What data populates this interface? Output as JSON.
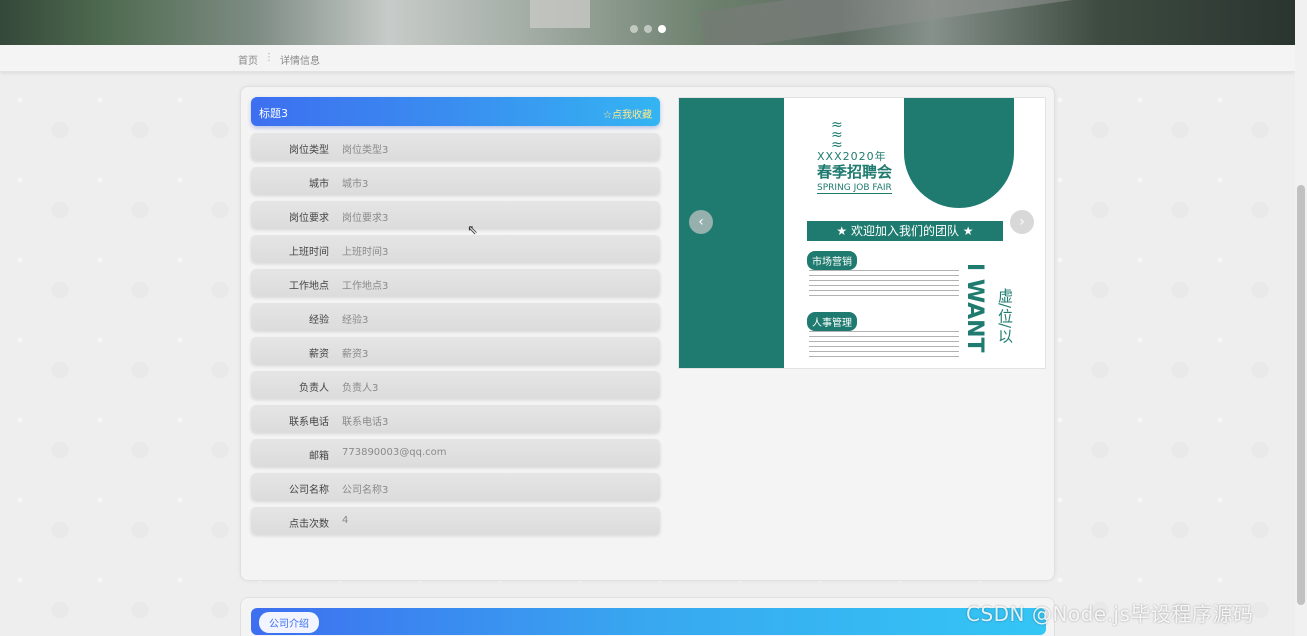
{
  "carousel": {
    "dots": 3,
    "active_index": 2
  },
  "breadcrumb": {
    "home": "首页",
    "separator": "⋮",
    "current": "详情信息"
  },
  "detail": {
    "title": "标题3",
    "favorite_label": "☆点我收藏",
    "fields": [
      {
        "label": "岗位类型",
        "value": "岗位类型3"
      },
      {
        "label": "城市",
        "value": "城市3"
      },
      {
        "label": "岗位要求",
        "value": "岗位要求3"
      },
      {
        "label": "上班时间",
        "value": "上班时间3"
      },
      {
        "label": "工作地点",
        "value": "工作地点3"
      },
      {
        "label": "经验",
        "value": "经验3"
      },
      {
        "label": "薪资",
        "value": "薪资3"
      },
      {
        "label": "负责人",
        "value": "负责人3"
      },
      {
        "label": "联系电话",
        "value": "联系电话3"
      },
      {
        "label": "邮箱",
        "value": "773890003@qq.com"
      },
      {
        "label": "公司名称",
        "value": "公司名称3"
      },
      {
        "label": "点击次数",
        "value": "4"
      }
    ]
  },
  "poster": {
    "year": "XXX2020年",
    "title_cn": "春季招聘会",
    "title_en": "SPRING JOB FAIR",
    "banner": "★ 欢迎加入我们的团队 ★",
    "section1": "市场营销",
    "section2": "人事管理",
    "side_text": "虚/位/以",
    "vertical_text": "I WANT",
    "prev_icon": "chevron-left-icon",
    "next_icon": "chevron-right-icon"
  },
  "intro": {
    "label": "公司介绍"
  },
  "watermark": "CSDN @Node.js毕设程序源码",
  "colors": {
    "accent": "#3d6ff0",
    "accent_end": "#34c6f5",
    "poster_green": "#1f7b6f",
    "favorite": "#ffe98a"
  }
}
